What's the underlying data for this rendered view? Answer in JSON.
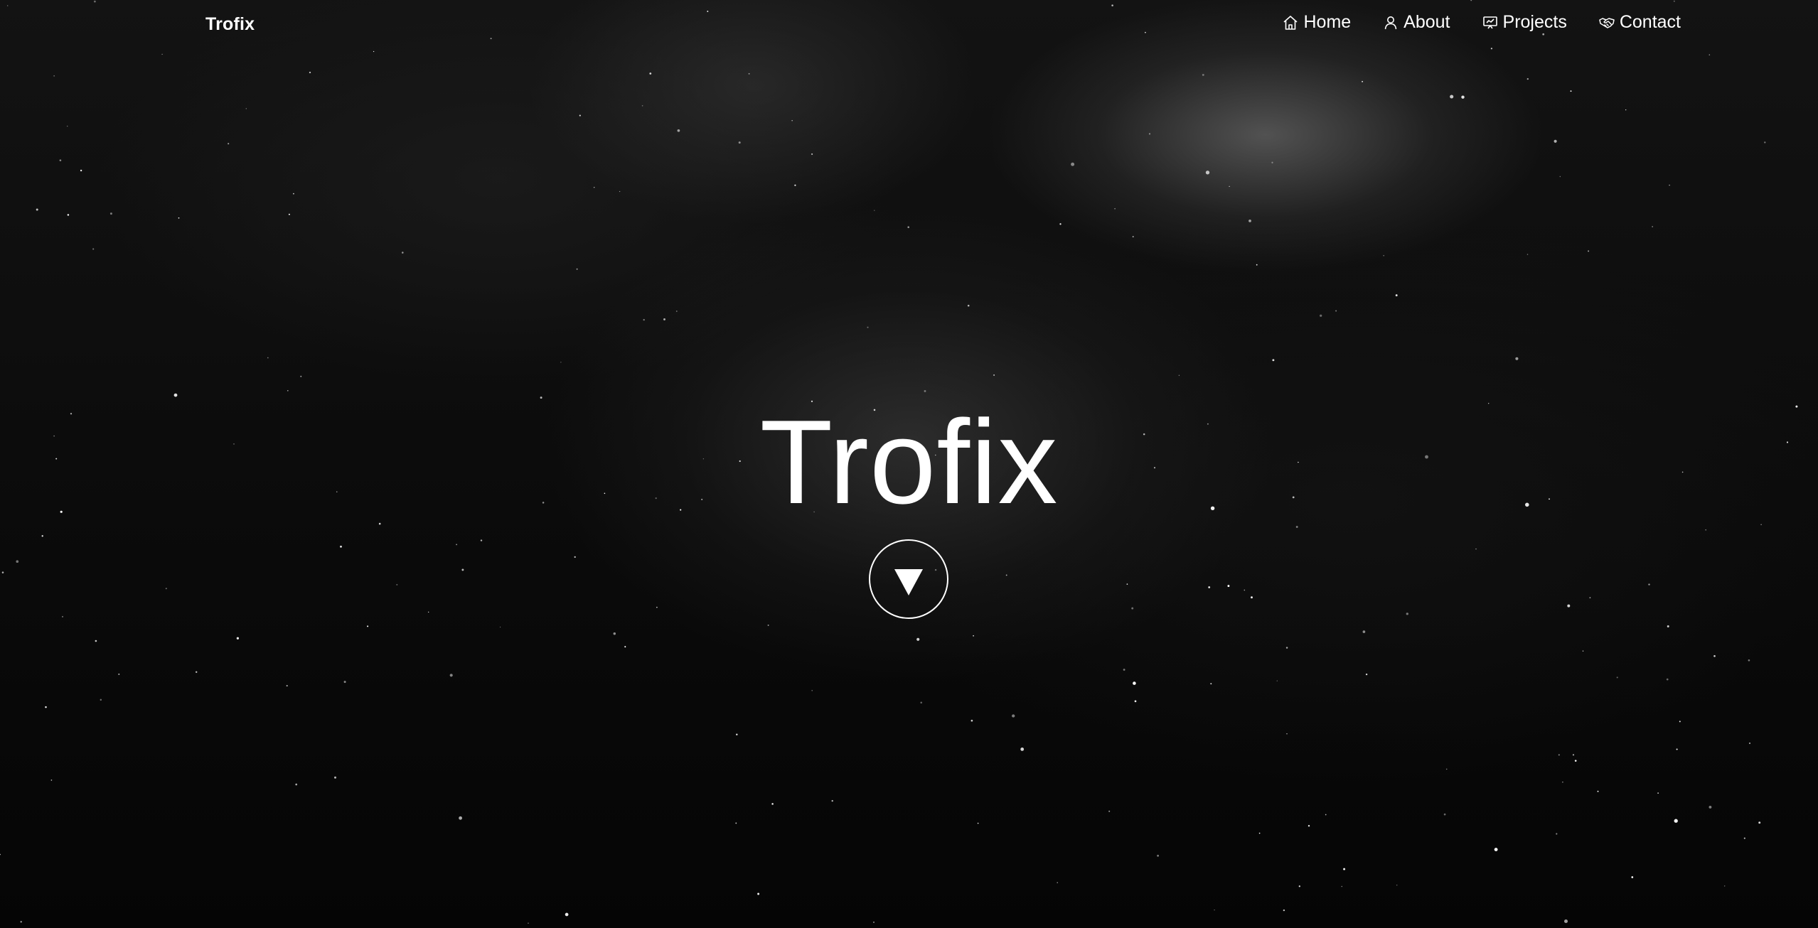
{
  "header": {
    "brand": "Trofix"
  },
  "nav": {
    "items": [
      {
        "label": "Home",
        "icon": "home-icon"
      },
      {
        "label": "About",
        "icon": "user-icon"
      },
      {
        "label": "Projects",
        "icon": "presentation-icon"
      },
      {
        "label": "Contact",
        "icon": "handshake-icon"
      }
    ]
  },
  "hero": {
    "title": "Trofix",
    "scroll_icon": "down-triangle-icon"
  },
  "colors": {
    "text": "#ffffff",
    "background": "#050505"
  }
}
